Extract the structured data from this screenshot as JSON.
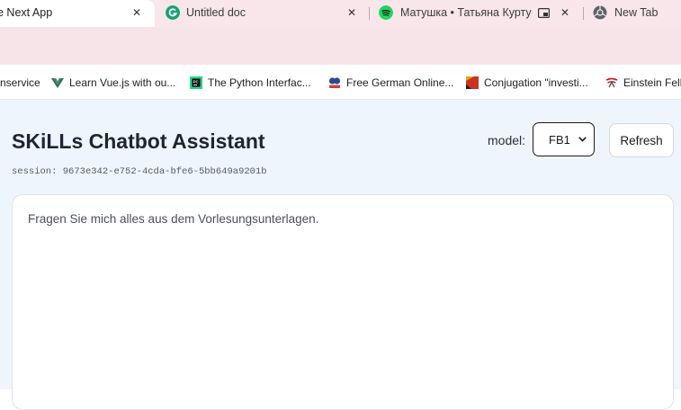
{
  "browser": {
    "tabs": [
      {
        "label": "e Next App",
        "active": true,
        "icon": "none"
      },
      {
        "label": "Untitled doc",
        "active": false,
        "icon": "grammarly-icon"
      },
      {
        "label": "Матушка • Татьяна Куртук",
        "active": false,
        "icon": "spotify-icon"
      },
      {
        "label": "New Tab",
        "active": false,
        "icon": "chrome-icon"
      }
    ],
    "close_glyph": "✕",
    "bookmarks": [
      {
        "label": "nservice",
        "icon": "none"
      },
      {
        "label": "Learn Vue.js with ou...",
        "icon": "vue-icon"
      },
      {
        "label": "The Python Interfac...",
        "icon": "pycharm-icon"
      },
      {
        "label": "Free German Online...",
        "icon": "language-site-icon"
      },
      {
        "label": "Conjugation \"investi...",
        "icon": "conjugation-icon"
      },
      {
        "label": "Einstein Fell",
        "icon": "einstein-icon"
      }
    ],
    "colors": {
      "tabstrip_bg": "#f8e6ea",
      "toolbar_bg": "#f7e4e8",
      "page_bg": "#eff5fd"
    }
  },
  "app": {
    "title": "SKiLLs Chatbot Assistant",
    "session_label": "session:",
    "session_id": "9673e342-e752-4cda-bfe6-5bb649a9201b",
    "model_label": "model:",
    "model_selected": "FB1",
    "refresh_label": "Refresh",
    "chat_placeholder": "Fragen Sie mich alles aus dem Vorlesungsunterlagen."
  }
}
